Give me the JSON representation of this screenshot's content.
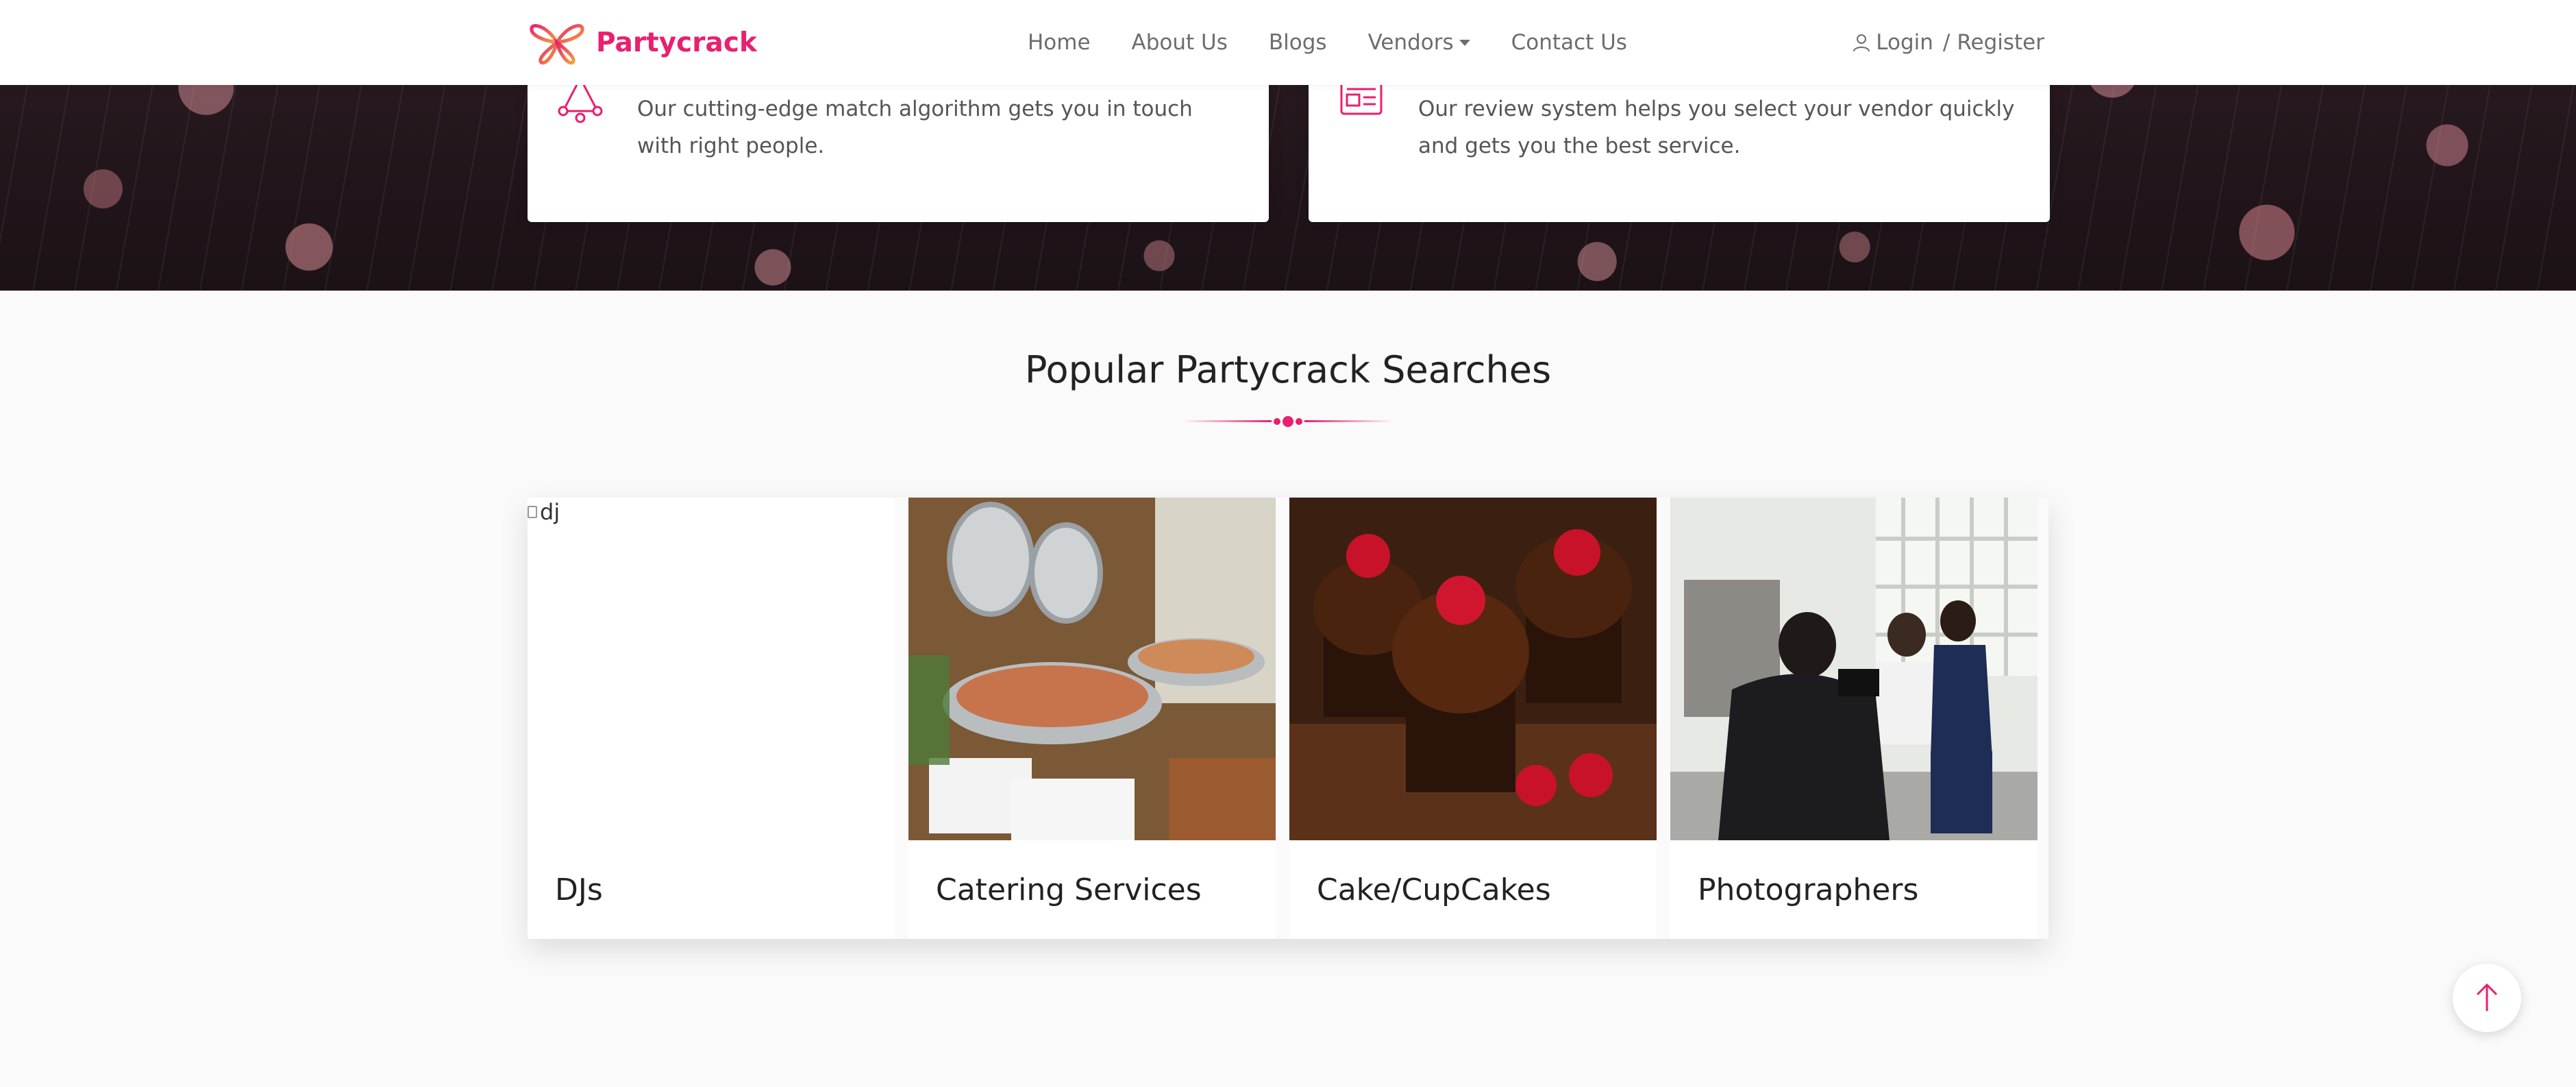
{
  "brand": {
    "name": "Partycrack",
    "logo_icon": "butterfly-logo-icon",
    "color": "#e8206f"
  },
  "nav": {
    "items": [
      {
        "label": "Home"
      },
      {
        "label": "About Us"
      },
      {
        "label": "Blogs"
      },
      {
        "label": "Vendors",
        "has_dropdown": true
      },
      {
        "label": "Contact Us"
      }
    ],
    "login_label": "Login",
    "separator": "/",
    "register_label": "Register",
    "user_icon": "user-icon"
  },
  "features": [
    {
      "icon": "network-triangle-icon",
      "text": "Our cutting-edge match algorithm gets you in touch with right people."
    },
    {
      "icon": "newspaper-icon",
      "text": "Our review system helps you select your vendor quickly and gets you the best service."
    }
  ],
  "section": {
    "title": "Popular Partycrack Searches"
  },
  "cards": [
    {
      "title": "DJs",
      "image_alt": "dj",
      "image_loaded": false
    },
    {
      "title": "Catering Services",
      "image_loaded": true
    },
    {
      "title": "Cake/CupCakes",
      "image_loaded": true
    },
    {
      "title": "Photographers",
      "image_loaded": true
    }
  ],
  "back_to_top_icon": "arrow-up-icon",
  "colors": {
    "accent": "#e8206f",
    "nav_text": "#6d6d6d",
    "page_bg": "#fafafa"
  }
}
